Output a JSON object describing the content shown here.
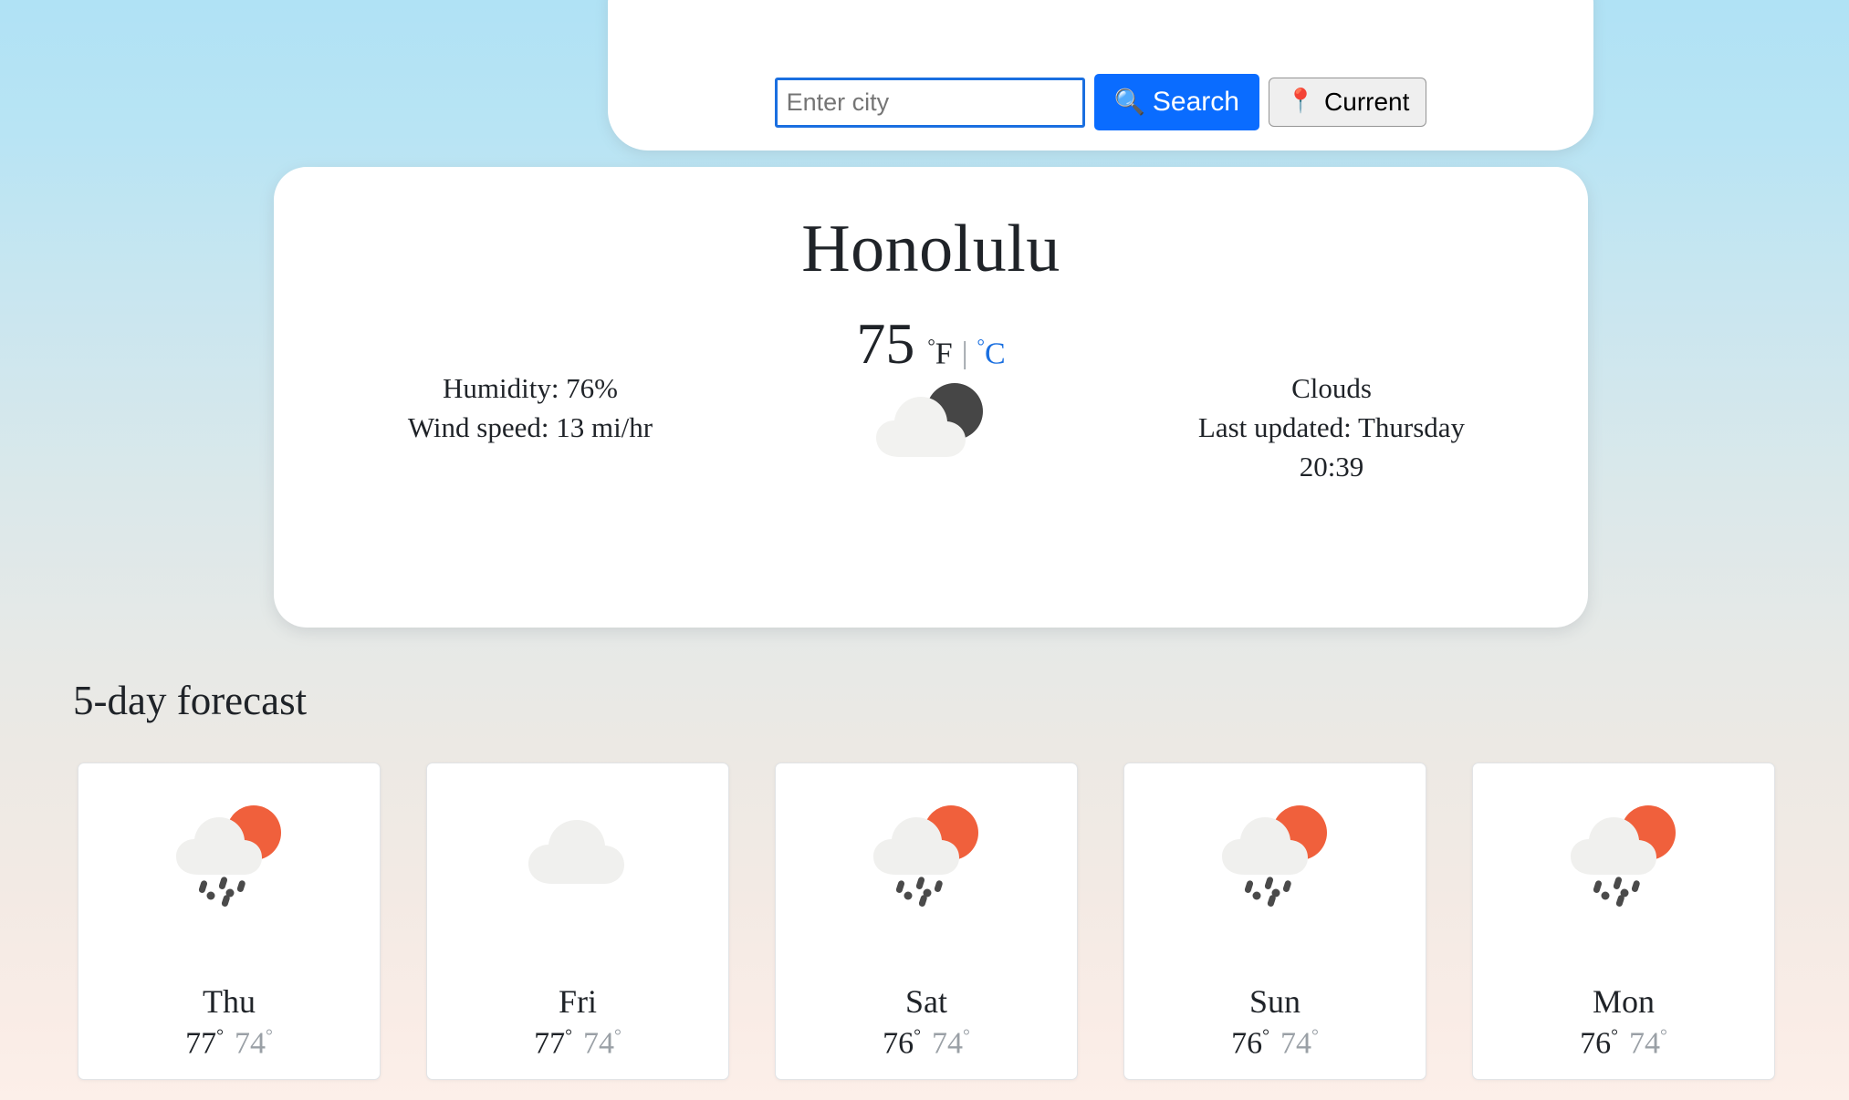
{
  "search": {
    "input_value": "",
    "placeholder": "Enter city",
    "search_label": "Search",
    "search_icon": "magnifier-icon",
    "current_label": "Current",
    "current_icon": "map-pin-icon",
    "accent_color": "#0a6cff",
    "input_focus_border": "#1a6fe0"
  },
  "current_weather": {
    "city": "Honolulu",
    "temperature": "75",
    "unit_f_label": "F",
    "unit_c_label": "C",
    "degree": "°",
    "unit_separator": "|",
    "active_unit": "F",
    "humidity": "Humidity: 76%",
    "wind": "Wind speed: 13 mi/hr",
    "condition": "Clouds",
    "last_updated": "Last updated: Thursday",
    "last_updated_time": "20:39",
    "icon": "sun-behind-cloud-icon"
  },
  "forecast": {
    "title": "5-day forecast",
    "days": [
      {
        "day": "Thu",
        "high": "77",
        "low": "74",
        "icon": "sun-behind-rain-cloud-icon"
      },
      {
        "day": "Fri",
        "high": "77",
        "low": "74",
        "icon": "cloud-icon"
      },
      {
        "day": "Sat",
        "high": "76",
        "low": "74",
        "icon": "sun-behind-rain-cloud-icon"
      },
      {
        "day": "Sun",
        "high": "76",
        "low": "74",
        "icon": "sun-behind-rain-cloud-icon"
      },
      {
        "day": "Mon",
        "high": "76",
        "low": "74",
        "icon": "sun-behind-rain-cloud-icon"
      }
    ]
  },
  "colors": {
    "sun_orange": "#f0603c",
    "cloud_gray": "#f0f0ee",
    "dark_cloud": "#4a4a4a",
    "low_temp_gray": "#9aa0a6",
    "link_blue": "#1a6fe0"
  }
}
